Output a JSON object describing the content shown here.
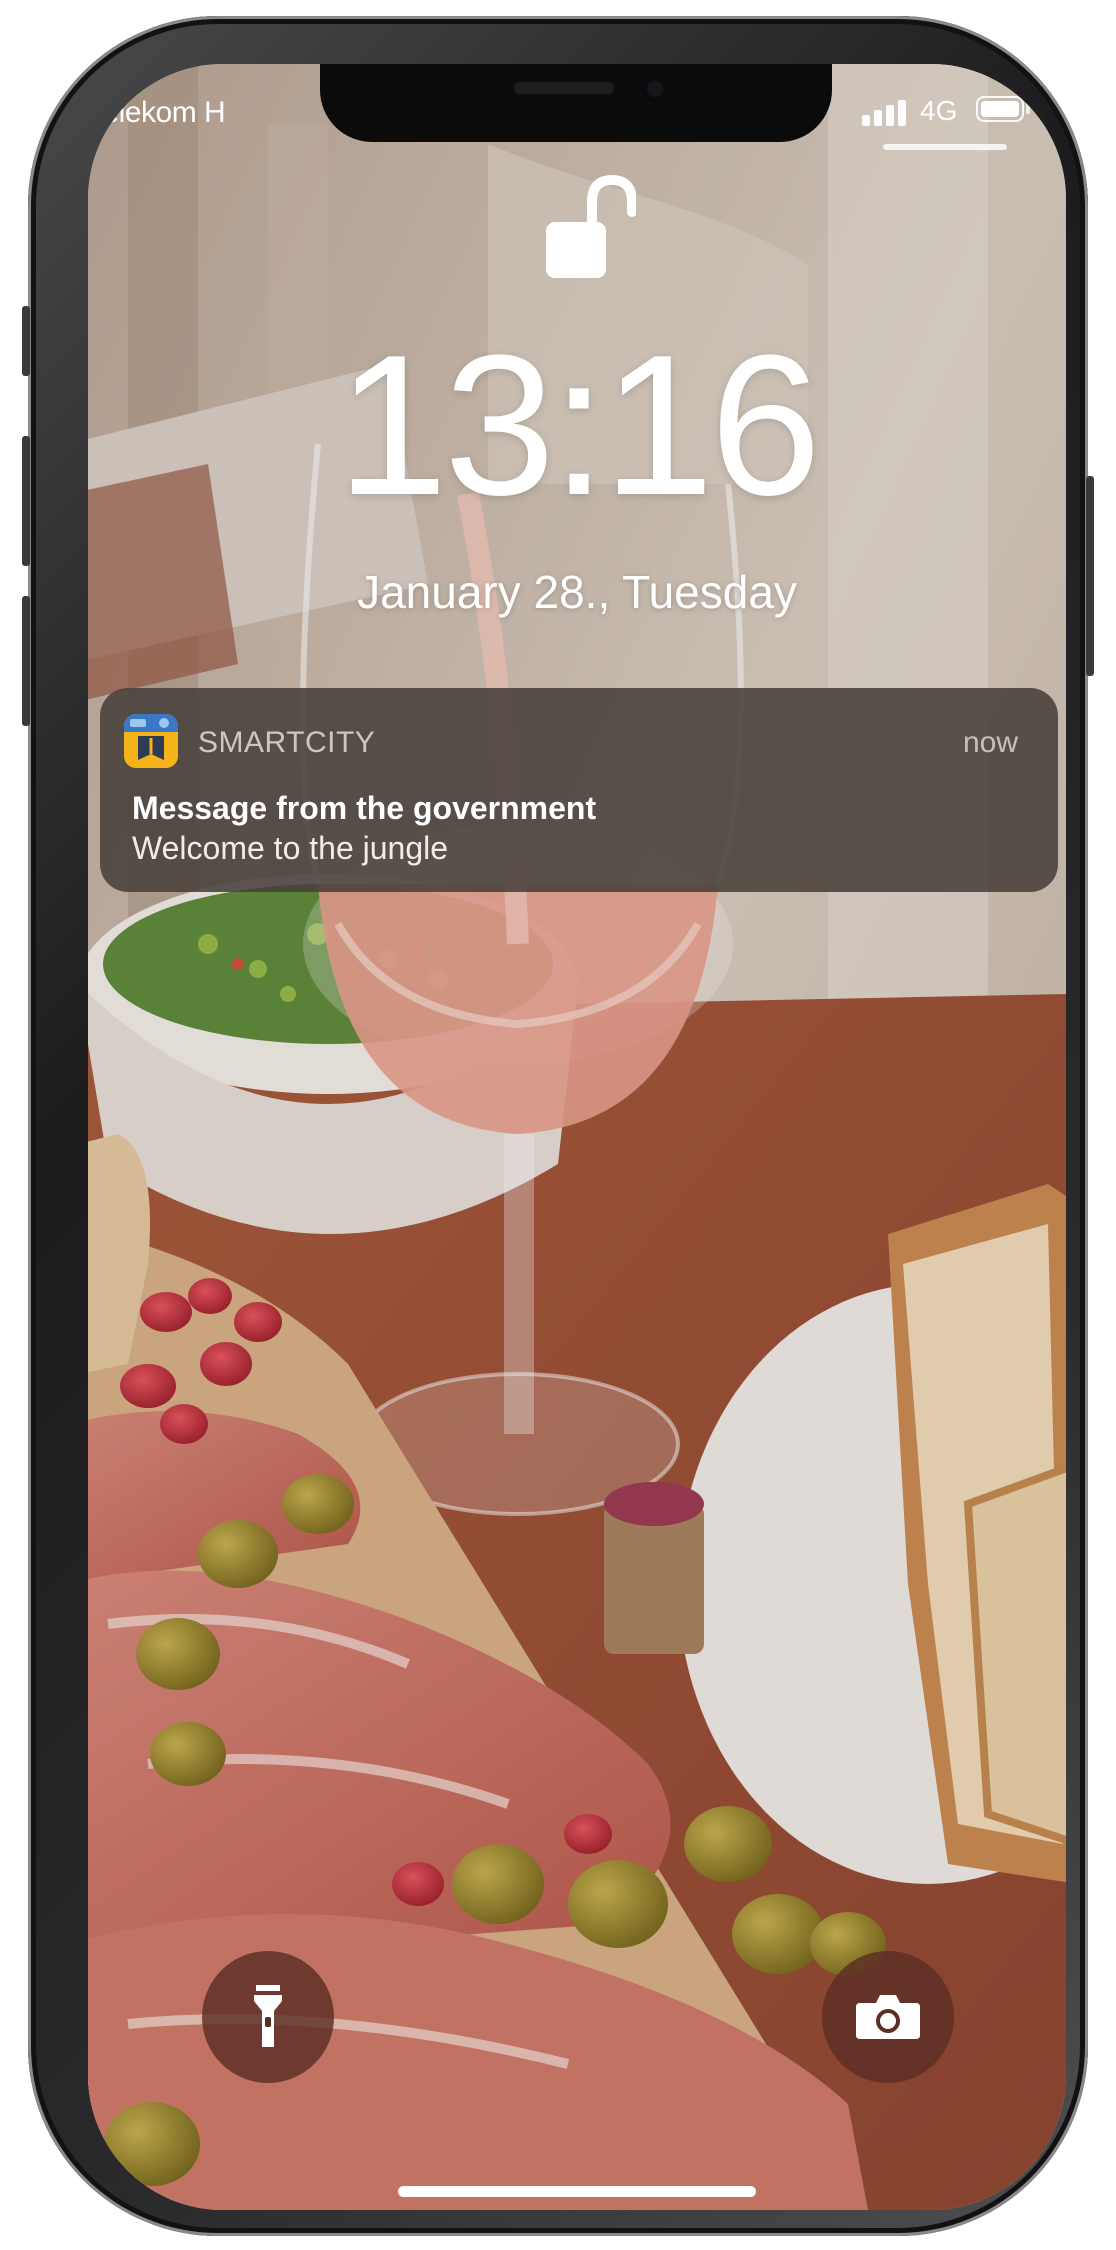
{
  "status_bar": {
    "carrier": "Telekom H",
    "network": "4G",
    "icons": [
      "signal-icon",
      "battery-icon"
    ]
  },
  "lock_screen": {
    "lock_icon": "unlocked-padlock-icon",
    "time": "13:16",
    "date": "January 28., Tuesday"
  },
  "notification": {
    "app_icon": "smartcity-app-icon",
    "app_name": "SMARTCITY",
    "time": "now",
    "title": "Message from the government",
    "body": "Welcome to the jungle"
  },
  "quick_actions": {
    "left": "flashlight-icon",
    "right": "camera-icon"
  },
  "colors": {
    "notification_bg": "#48403a",
    "quick_button_bg": "#5c2e24"
  }
}
